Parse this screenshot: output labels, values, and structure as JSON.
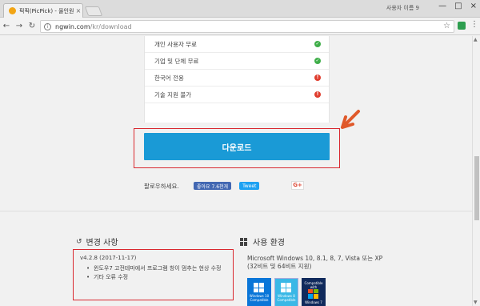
{
  "browser": {
    "tab_title": "픽픽(PicPick) - 올인원 그",
    "tab_close": "×",
    "profile": "사용자 이름 9",
    "window_buttons": [
      "—",
      "□",
      "×"
    ],
    "url_domain": "ngwin.com",
    "url_path": "/kr/download"
  },
  "features": [
    {
      "label": "개인 사용자 무료",
      "status": "yes"
    },
    {
      "label": "기업 및 단체 무료",
      "status": "yes"
    },
    {
      "label": "한국어 전용",
      "status": "no"
    },
    {
      "label": "기술 지원 불가",
      "status": "no"
    }
  ],
  "download": {
    "label": "다운로드"
  },
  "share": {
    "label": "팔로우하세요.",
    "facebook": "좋아요 7.6천개",
    "twitter": "Tweet",
    "google": "G+"
  },
  "changes": {
    "title": "변경 사항",
    "version": "v4.2.8 (2017-11-17)",
    "items": [
      "윈도우7 고전테마에서 프로그램 창이 멈추는 현상 수정",
      "기타 오류 수정"
    ]
  },
  "environment": {
    "title": "사용 환경",
    "text": "Microsoft Windows 10, 8.1, 8, 7, Vista 또는 XP (32비트 및 64비트 지원)",
    "badges": [
      {
        "name": "Windows 10",
        "sub": "Compatible"
      },
      {
        "name": "Windows 8",
        "sub": "Compatible"
      },
      {
        "name": "Windows 7",
        "sub": "Compatible with"
      }
    ]
  },
  "colors": {
    "download_button": "#1a9ad6",
    "highlight_box": "#d9282f",
    "arrow": "#e0592a",
    "check": "#3fae49",
    "cross": "#e03d2e"
  }
}
